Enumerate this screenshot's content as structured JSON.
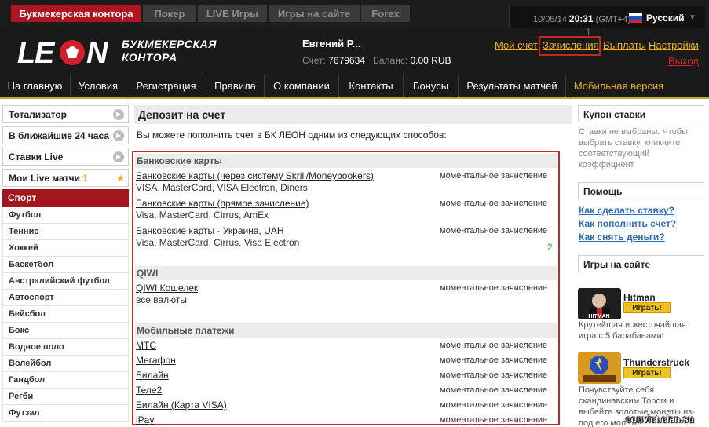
{
  "top_tabs": [
    "Букмекерская контора",
    "Покер",
    "LIVE Игры",
    "Игры на сайте",
    "Forex"
  ],
  "datetime": {
    "date": "10/05/14",
    "time": "20:31",
    "tz": "(GMT+4)"
  },
  "language": "Русский",
  "brand": {
    "logo_text": "LEON",
    "line1": "БУКМЕКЕРСКАЯ",
    "line2": "КОНТОРА"
  },
  "user": {
    "name": "Евгений Р...",
    "account_label": "Счет:",
    "account_number": "7679634",
    "balance_label": "Баланс:",
    "balance_value": "0.00 RUB"
  },
  "header_links": {
    "my_account": "Мой счет",
    "deposits": "Зачисления",
    "payouts": "Выплаты",
    "settings": "Настройки",
    "logout": "Выход"
  },
  "annotations": {
    "a1": "1",
    "a2": "2"
  },
  "nav": [
    "На главную",
    "Условия",
    "Регистрация",
    "Правила",
    "О компании",
    "Контакты",
    "Бонусы",
    "Результаты матчей",
    "Мобильная версия"
  ],
  "left_menu": {
    "totalizator": "Тотализатор",
    "next24": "В ближайшие 24 часа",
    "live_bets": "Ставки Live",
    "my_live": "Мои Live матчи",
    "my_live_count": "1",
    "sport_header": "Спорт",
    "sports": [
      "Футбол",
      "Теннис",
      "Хоккей",
      "Баскетбол",
      "Австралийский футбол",
      "Автоспорт",
      "Бейсбол",
      "Бокс",
      "Водное поло",
      "Волейбол",
      "Гандбол",
      "Регби",
      "Футзал"
    ]
  },
  "main": {
    "title": "Депозит на счет",
    "intro": "Вы можете пополнить счет в БК ЛЕОН одним из следующих способов:",
    "sections": [
      {
        "name": "Банковские карты",
        "methods": [
          {
            "name": "Банковские карты (через систему Skrill/Moneybookers)",
            "sub": "VISA, MasterCard, VISA Electron, Diners.",
            "status": "моментальное зачисление"
          },
          {
            "name": "Банковские карты (прямое зачисление)",
            "sub": "Visa, MasterCard, Cirrus, AmEx",
            "status": "моментальное зачисление"
          },
          {
            "name": "Банковские карты - Украина, UAH",
            "sub": "Visa, MasterCard, Cirrus, Visa Electron",
            "status": "моментальное зачисление"
          }
        ]
      },
      {
        "name": "QIWI",
        "methods": [
          {
            "name": "QIWI Кошелек",
            "sub": "все валюты",
            "status": "моментальное зачисление"
          }
        ]
      },
      {
        "name": "Мобильные платежи",
        "methods": [
          {
            "name": "МТС",
            "status": "моментальное зачисление"
          },
          {
            "name": "Мегафон",
            "status": "моментальное зачисление"
          },
          {
            "name": "Билайн",
            "status": "моментальное зачисление"
          },
          {
            "name": "Теле2",
            "status": "моментальное зачисление"
          },
          {
            "name": "Билайн (Карта VISA)",
            "status": "моментальное зачисление"
          },
          {
            "name": "iPay",
            "status": "моментальное зачисление"
          }
        ]
      }
    ]
  },
  "right": {
    "coupon_title": "Купон ставки",
    "coupon_text": "Ставки не выбраны. Чтобы выбрать ставку, кликните соответствующий коэффициент.",
    "help_title": "Помощь",
    "help_links": [
      "Как сделать ставку?",
      "Как пополнить счет?",
      "Как снять деньги?"
    ],
    "games_title": "Игры на сайте",
    "games": [
      {
        "name": "Hitman",
        "button": "Играть!",
        "desc": "Крутейшая и жесточайшая игра с 5 барабанами!",
        "thumb_text": "HITMAN"
      },
      {
        "name": "Thunderstruck",
        "button": "Играть!",
        "desc": "Почувствуйте себя скандинавским Тором и выбейте золотые монеты из-под его молота!"
      }
    ]
  },
  "watermark": "convict.clan.su",
  "colors": {
    "brand_red": "#b01620",
    "gold": "#e8b21b",
    "link_blue": "#2a6db3",
    "highlight_red": "#c62828",
    "annotation_green": "#3aa23a"
  }
}
